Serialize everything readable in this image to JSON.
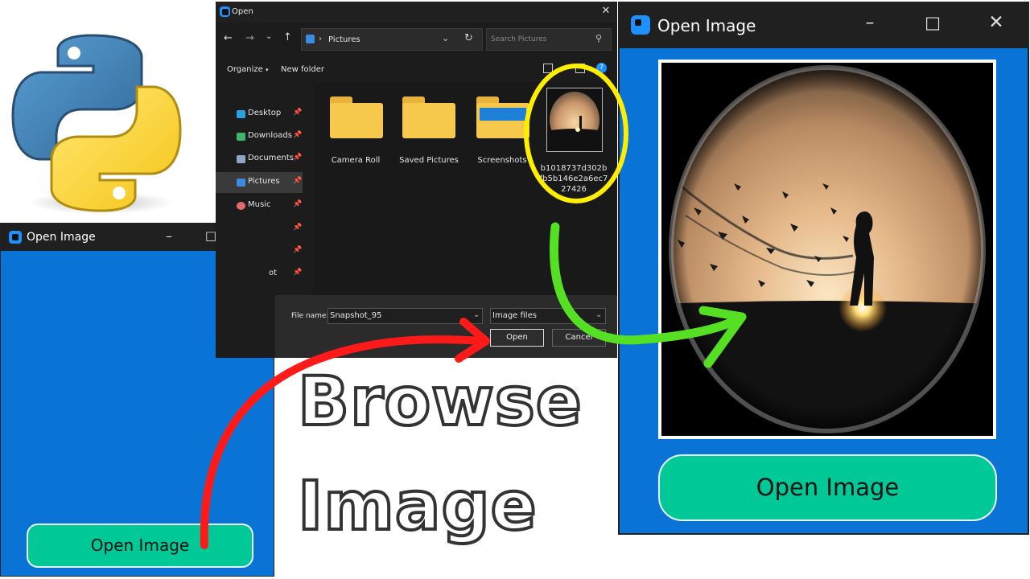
{
  "file_dialog": {
    "title": "Open",
    "address_path": "Pictures",
    "search_placeholder": "Search Pictures",
    "toolbar": {
      "organize": "Organize",
      "new_folder": "New folder"
    },
    "sidebar": [
      {
        "label": "Desktop",
        "icon": "desktop-icon",
        "color": "#2aa1e0"
      },
      {
        "label": "Downloads",
        "icon": "download-icon",
        "color": "#3fb46b"
      },
      {
        "label": "Documents",
        "icon": "documents-icon",
        "color": "#8fa6c9"
      },
      {
        "label": "Pictures",
        "icon": "pictures-icon",
        "color": "#3b8be0",
        "selected": true
      },
      {
        "label": "Music",
        "icon": "music-icon",
        "color": "#e26a6a"
      },
      {
        "label": "",
        "icon": "folder-icon",
        "color": "#555"
      },
      {
        "label": "",
        "icon": "folder-icon",
        "color": "#555"
      },
      {
        "label": "ot",
        "icon": "folder-icon",
        "color": "#555"
      }
    ],
    "items": [
      {
        "label": "Camera Roll",
        "type": "folder"
      },
      {
        "label": "Saved Pictures",
        "type": "folder"
      },
      {
        "label": "Screenshots",
        "type": "folder"
      },
      {
        "label": "b1018737d302bfb5b146e2a6ec727426",
        "label_lines": [
          "b1018737d302b",
          "fb5b146e2a6ec7",
          "27426"
        ],
        "type": "image"
      }
    ],
    "file_name_label": "File name:",
    "file_name_value": "Snapshot_95",
    "file_type_value": "Image files",
    "open_button": "Open",
    "cancel_button": "Cancel"
  },
  "small_window": {
    "title": "Open Image",
    "button_label": "Open Image"
  },
  "big_window": {
    "title": "Open Image",
    "button_label": "Open Image"
  },
  "overlay_text": {
    "line1": "Browse",
    "line2": "Image"
  },
  "colors": {
    "app_blue": "#0a74d6",
    "button_green": "#00c896",
    "annotation_red": "#ff1a1a",
    "annotation_green": "#55e024",
    "annotation_yellow": "#ffee00"
  }
}
